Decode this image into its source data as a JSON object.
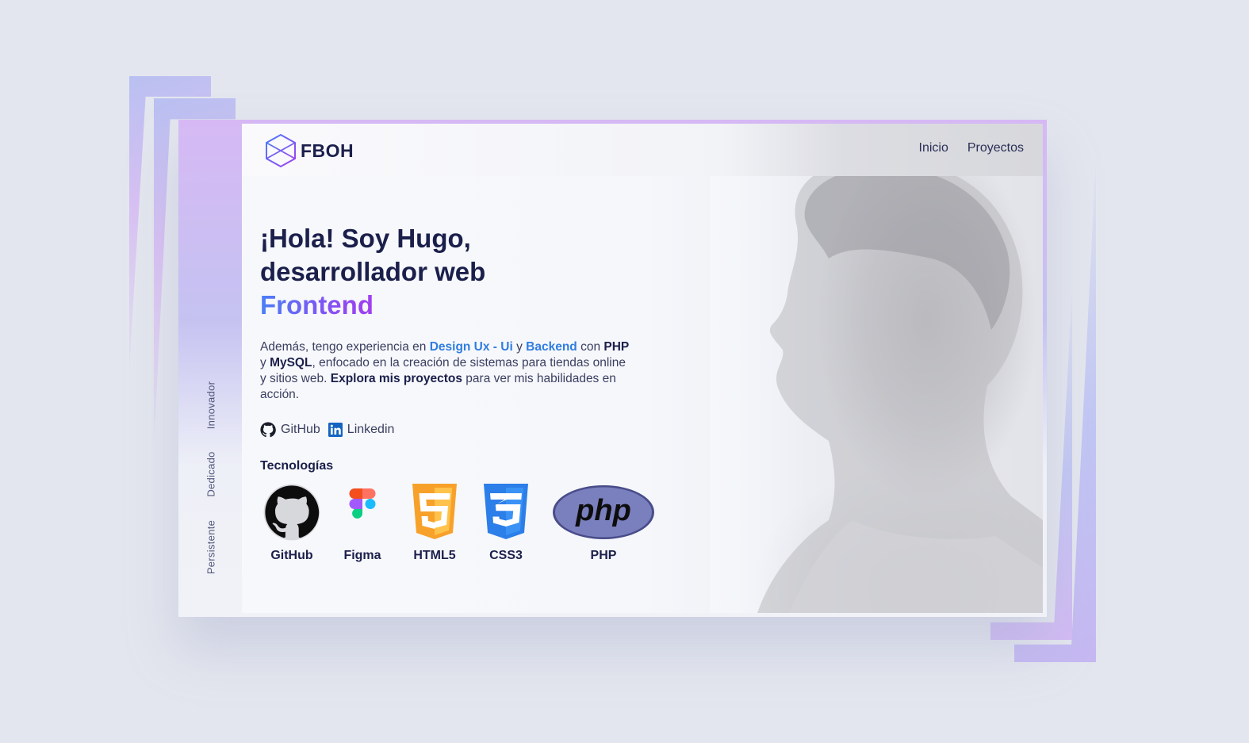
{
  "brand": {
    "name": "FBOH"
  },
  "nav": {
    "items": [
      "Inicio",
      "Proyectos"
    ]
  },
  "side_words": [
    "Innovador",
    "Dedicado",
    "Persistente"
  ],
  "hero": {
    "line1": "¡Hola! Soy Hugo,",
    "line2": "desarrollador web",
    "accent": "Frontend"
  },
  "description": {
    "p1": "Además, tengo experiencia en ",
    "hl1": "Design Ux - Ui",
    "p2": " y ",
    "hl2": "Backend",
    "p3": " con ",
    "b1": "PHP",
    "p4": " y ",
    "b2": "MySQL",
    "p5": ", enfocado en la creación de sistemas para tiendas online y sitios web. ",
    "b3": "Explora mis proyectos",
    "p6": " para ver mis habilidades en acción."
  },
  "social": [
    {
      "label": "GitHub",
      "icon": "github-icon"
    },
    {
      "label": "Linkedin",
      "icon": "linkedin-icon"
    }
  ],
  "technologies": {
    "title": "Tecnologías",
    "items": [
      {
        "label": "GitHub",
        "icon": "github-logo"
      },
      {
        "label": "Figma",
        "icon": "figma-logo"
      },
      {
        "label": "HTML5",
        "icon": "html5-logo"
      },
      {
        "label": "CSS3",
        "icon": "css3-logo"
      },
      {
        "label": "PHP",
        "icon": "php-logo"
      }
    ]
  },
  "colors": {
    "background": "#e3e6ee",
    "text_dark": "#1b1f4b",
    "highlight_blue": "#2f7de0",
    "accent_start": "#4a7ef7",
    "accent_end": "#a23ff0",
    "html5_orange": "#f7a12b",
    "css3_blue": "#2c7ee8",
    "php_purple": "#7a7fbd"
  }
}
